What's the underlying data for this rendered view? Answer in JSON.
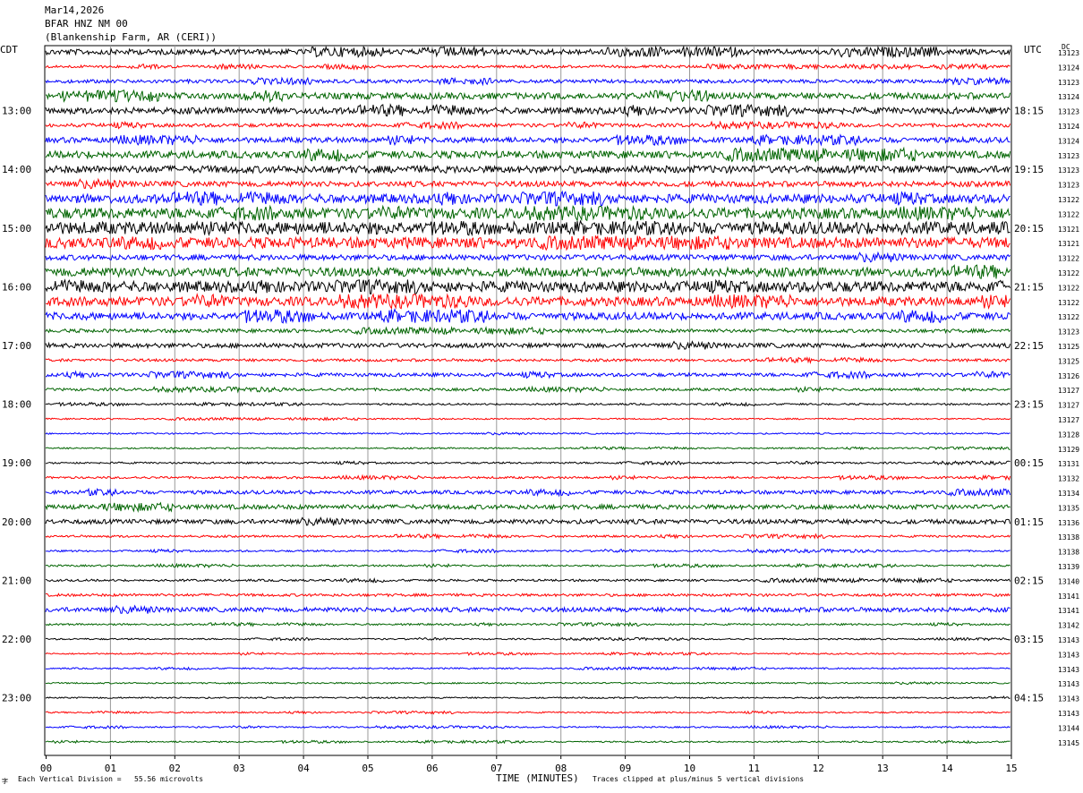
{
  "header": {
    "date": "Mar14,2026",
    "station": "BFAR HNZ NM 00",
    "site": "(Blankenship Farm, AR (CERI))"
  },
  "left_tz": "CDT",
  "right_tz": "UTC",
  "dc_label": "DC",
  "footer": {
    "division": "Each Vertical Division =   55.56 microvolts",
    "xlabel": "TIME (MINUTES)",
    "clip": "Traces clipped at plus/minus 5 vertical divisions",
    "corner": "字"
  },
  "colors": [
    "#000000",
    "#ff0000",
    "#0000ff",
    "#006400"
  ],
  "chart_data": {
    "type": "line",
    "xlabel": "TIME (MINUTES)",
    "xlim": [
      0,
      15
    ],
    "x_ticks": [
      "00",
      "01",
      "02",
      "03",
      "04",
      "05",
      "06",
      "07",
      "08",
      "09",
      "10",
      "11",
      "12",
      "13",
      "14",
      "15"
    ],
    "left_hour_labels": [
      "13:00",
      "14:00",
      "15:00",
      "16:00",
      "17:00",
      "18:00",
      "19:00",
      "20:00",
      "21:00",
      "22:00",
      "23:00"
    ],
    "right_hour_labels": [
      "18:15",
      "19:15",
      "20:15",
      "21:15",
      "22:15",
      "23:15",
      "00:15",
      "01:15",
      "02:15",
      "03:15",
      "04:15"
    ],
    "dc_offsets": [
      "13123",
      "13124",
      "13123",
      "13124",
      "13123",
      "13124",
      "13124",
      "13123",
      "13123",
      "13123",
      "13122",
      "13122",
      "13121",
      "13121",
      "13122",
      "13122",
      "13122",
      "13122",
      "13122",
      "13123",
      "13125",
      "13125",
      "13126",
      "13127",
      "13127",
      "13127",
      "13128",
      "13129",
      "13131",
      "13132",
      "13134",
      "13135",
      "13136",
      "13138",
      "13138",
      "13139",
      "13140",
      "13141",
      "13141",
      "13142",
      "13143",
      "13143",
      "13143",
      "13143",
      "13143",
      "13143",
      "13144",
      "13145"
    ],
    "trace_amplitudes": [
      3,
      1.5,
      2,
      3.5,
      3.5,
      2,
      3,
      4,
      4,
      3,
      5,
      6,
      7,
      6,
      3,
      5,
      6,
      5,
      4,
      2,
      2.5,
      1.5,
      2,
      1.5,
      1,
      0.8,
      0.8,
      0.8,
      1,
      1.2,
      2,
      2.5,
      2.5,
      1.2,
      1,
      1,
      1.2,
      1.5,
      2.5,
      1,
      0.8,
      0.8,
      0.8,
      0.8,
      0.8,
      0.8,
      0.8,
      0.8
    ]
  }
}
